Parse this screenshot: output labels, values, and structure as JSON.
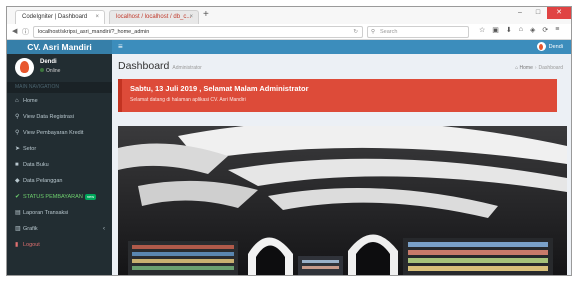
{
  "browser": {
    "tabs": [
      {
        "label": "CodeIgniter | Dashboard",
        "active": true
      },
      {
        "label": "localhost / localhost / db_c...",
        "active": false
      }
    ],
    "new_tab": "+",
    "url": "localhost/skripsi_asri_mandiri/?_home_admin",
    "search_placeholder": "Search",
    "window_controls": [
      "–",
      "□",
      "✕"
    ]
  },
  "app": {
    "brand": "CV. Asri Mandiri",
    "user": {
      "name": "Dendi",
      "status": "Online"
    },
    "menu_header": "MAIN NAVIGATION",
    "menu": [
      {
        "label": "Home",
        "icon": "home-icon",
        "glyph": "⌂",
        "style": "normal"
      },
      {
        "label": "View Data Registrasi",
        "icon": "search-icon",
        "glyph": "⚲",
        "style": "normal"
      },
      {
        "label": "View Pembayaran Kredit",
        "icon": "search-icon",
        "glyph": "⚲",
        "style": "normal"
      },
      {
        "label": "Setor",
        "icon": "arrow-icon",
        "glyph": "➤",
        "style": "normal"
      },
      {
        "label": "Data Buku",
        "icon": "book-icon",
        "glyph": "■",
        "style": "normal"
      },
      {
        "label": "Data Pelanggan",
        "icon": "users-icon",
        "glyph": "◆",
        "style": "normal"
      },
      {
        "label": "STATUS PEMBAYARAN",
        "icon": "check-icon",
        "glyph": "✔",
        "style": "green",
        "badge": "new"
      },
      {
        "label": "Laporan Transaksi",
        "icon": "print-icon",
        "glyph": "▤",
        "style": "normal"
      },
      {
        "label": "Grafik",
        "icon": "chart-icon",
        "glyph": "▥",
        "style": "normal",
        "chevron": "‹"
      },
      {
        "label": "Logout",
        "icon": "logout-icon",
        "glyph": "▮",
        "style": "red"
      }
    ],
    "topbar_user": "Dendi",
    "page_title": "Dashboard",
    "page_subtitle": "Administrator",
    "breadcrumb": [
      "Home",
      "Dashboard"
    ],
    "callout": {
      "title": "Sabtu, 13 Juli 2019 , Selamat Malam Administrator",
      "text": "Selamat datang di halaman aplikasi CV. Asri Mandiri"
    },
    "colors": {
      "sidebar": "#222d32",
      "brand": "#367fa9",
      "topbar": "#3c8dbc",
      "callout": "#dd4b39"
    }
  }
}
